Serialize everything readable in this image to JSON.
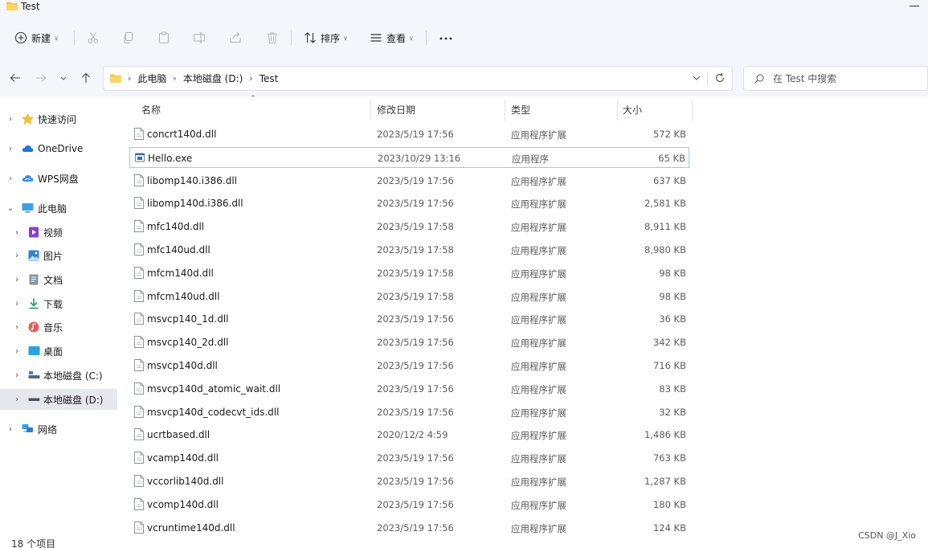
{
  "window": {
    "title": "Test"
  },
  "toolbar": {
    "new_label": "新建",
    "sort_label": "排序",
    "view_label": "查看"
  },
  "address": {
    "crumbs": [
      "此电脑",
      "本地磁盘 (D:)",
      "Test"
    ]
  },
  "search": {
    "placeholder": "在 Test 中搜索"
  },
  "sidebar": {
    "items": [
      {
        "label": "快速访问",
        "icon": "star-icon"
      },
      {
        "label": "OneDrive",
        "icon": "cloud-icon"
      },
      {
        "label": "WPS网盘",
        "icon": "wps-cloud-icon"
      },
      {
        "label": "此电脑",
        "icon": "computer-icon"
      },
      {
        "label": "视频",
        "icon": "video-icon"
      },
      {
        "label": "图片",
        "icon": "picture-icon"
      },
      {
        "label": "文档",
        "icon": "document-icon"
      },
      {
        "label": "下载",
        "icon": "download-icon"
      },
      {
        "label": "音乐",
        "icon": "music-icon"
      },
      {
        "label": "桌面",
        "icon": "desktop-icon"
      },
      {
        "label": "本地磁盘 (C:)",
        "icon": "drive-icon"
      },
      {
        "label": "本地磁盘 (D:)",
        "icon": "drive-icon"
      },
      {
        "label": "网络",
        "icon": "network-icon"
      }
    ]
  },
  "columns": {
    "name": "名称",
    "date": "修改日期",
    "type": "类型",
    "size": "大小"
  },
  "files": [
    {
      "name": "concrt140d.dll",
      "date": "2023/5/19 17:56",
      "type": "应用程序扩展",
      "size": "572 KB"
    },
    {
      "name": "Hello.exe",
      "date": "2023/10/29 13:16",
      "type": "应用程序",
      "size": "65 KB"
    },
    {
      "name": "libomp140.i386.dll",
      "date": "2023/5/19 17:56",
      "type": "应用程序扩展",
      "size": "637 KB"
    },
    {
      "name": "libomp140d.i386.dll",
      "date": "2023/5/19 17:56",
      "type": "应用程序扩展",
      "size": "2,581 KB"
    },
    {
      "name": "mfc140d.dll",
      "date": "2023/5/19 17:58",
      "type": "应用程序扩展",
      "size": "8,911 KB"
    },
    {
      "name": "mfc140ud.dll",
      "date": "2023/5/19 17:58",
      "type": "应用程序扩展",
      "size": "8,980 KB"
    },
    {
      "name": "mfcm140d.dll",
      "date": "2023/5/19 17:58",
      "type": "应用程序扩展",
      "size": "98 KB"
    },
    {
      "name": "mfcm140ud.dll",
      "date": "2023/5/19 17:58",
      "type": "应用程序扩展",
      "size": "98 KB"
    },
    {
      "name": "msvcp140_1d.dll",
      "date": "2023/5/19 17:56",
      "type": "应用程序扩展",
      "size": "36 KB"
    },
    {
      "name": "msvcp140_2d.dll",
      "date": "2023/5/19 17:56",
      "type": "应用程序扩展",
      "size": "342 KB"
    },
    {
      "name": "msvcp140d.dll",
      "date": "2023/5/19 17:56",
      "type": "应用程序扩展",
      "size": "716 KB"
    },
    {
      "name": "msvcp140d_atomic_wait.dll",
      "date": "2023/5/19 17:56",
      "type": "应用程序扩展",
      "size": "83 KB"
    },
    {
      "name": "msvcp140d_codecvt_ids.dll",
      "date": "2023/5/19 17:56",
      "type": "应用程序扩展",
      "size": "32 KB"
    },
    {
      "name": "ucrtbased.dll",
      "date": "2020/12/2 4:59",
      "type": "应用程序扩展",
      "size": "1,486 KB"
    },
    {
      "name": "vcamp140d.dll",
      "date": "2023/5/19 17:56",
      "type": "应用程序扩展",
      "size": "763 KB"
    },
    {
      "name": "vccorlib140d.dll",
      "date": "2023/5/19 17:56",
      "type": "应用程序扩展",
      "size": "1,287 KB"
    },
    {
      "name": "vcomp140d.dll",
      "date": "2023/5/19 17:56",
      "type": "应用程序扩展",
      "size": "180 KB"
    },
    {
      "name": "vcruntime140d.dll",
      "date": "2023/5/19 17:56",
      "type": "应用程序扩展",
      "size": "124 KB"
    }
  ],
  "selected_file": "Hello.exe",
  "status": {
    "count": "18 个项目"
  },
  "watermark": "CSDN @J_Xio",
  "colors": {
    "accent": "#0067c0",
    "chrome_bg": "#f3f6fb",
    "selection_border": "#99c9ef",
    "folder": "#f8c541"
  }
}
